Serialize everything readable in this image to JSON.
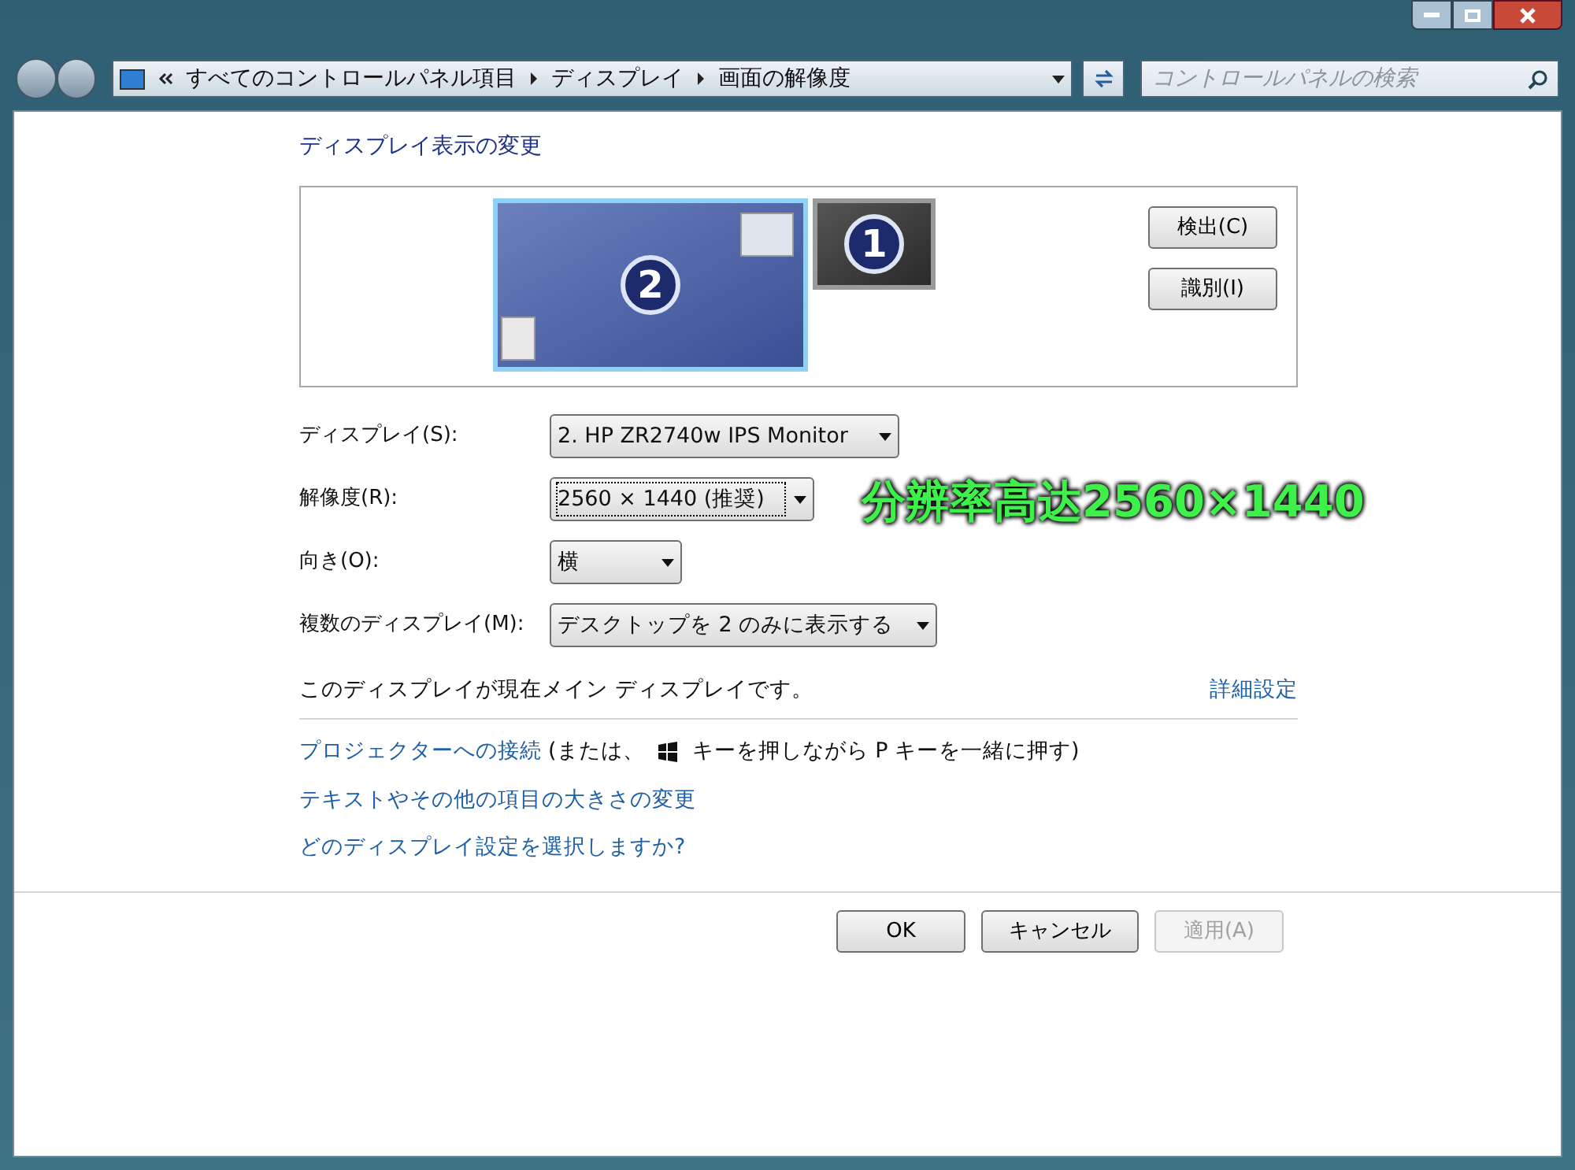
{
  "address_bar": {
    "crumbs": [
      "すべてのコントロールパネル項目",
      "ディスプレイ",
      "画面の解像度"
    ]
  },
  "search": {
    "placeholder": "コントロールパネルの検索"
  },
  "heading": "ディスプレイ表示の変更",
  "monitors": [
    {
      "number": "2",
      "selected": true
    },
    {
      "number": "1",
      "selected": false
    }
  ],
  "monitor_buttons": [
    "検出(C)",
    "識別(I)"
  ],
  "settings": [
    {
      "label": "ディスプレイ(S):",
      "value": "2. HP ZR2740w IPS Monitor",
      "focused": false
    },
    {
      "label": "解像度(R):",
      "value": "2560 × 1440 (推奨)",
      "focused": true
    },
    {
      "label": "向き(O):",
      "value": "横",
      "focused": false
    },
    {
      "label": "複数のディスプレイ(M):",
      "value": "デスクトップを 2 のみに表示する",
      "focused": false
    }
  ],
  "overlay_caption": "分辨率高达2560×1440",
  "main_display_note": "このディスプレイが現在メイン ディスプレイです。",
  "advanced_link": "詳細設定",
  "projector": {
    "link": "プロジェクターへの接続",
    "before_icon": "(または、",
    "after_icon": "キーを押しながら P キーを一緒に押す)"
  },
  "links": [
    "テキストやその他の項目の大きさの変更",
    "どのディスプレイ設定を選択しますか?"
  ],
  "buttons": [
    {
      "label": "OK",
      "disabled": false
    },
    {
      "label": "キャンセル",
      "disabled": false
    },
    {
      "label": "適用(A)",
      "disabled": true
    }
  ]
}
